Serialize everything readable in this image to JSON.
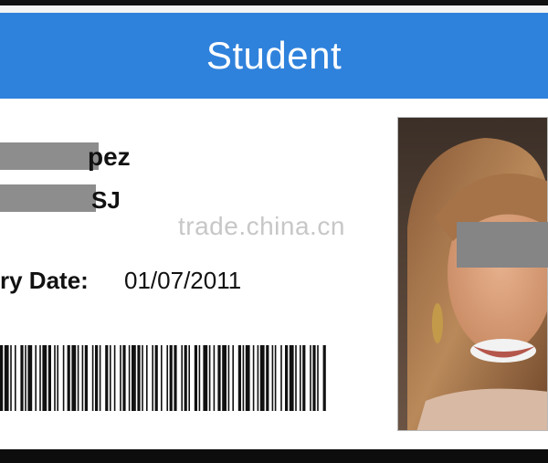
{
  "card": {
    "title": "Student",
    "name_visible": "pez",
    "id_visible": "SJ",
    "expiry_label": "ry Date:",
    "expiry_value": "01/07/2011",
    "watermark": "trade.china.cn"
  },
  "colors": {
    "header": "#2f82dc",
    "redaction": "#8d8d8d"
  }
}
